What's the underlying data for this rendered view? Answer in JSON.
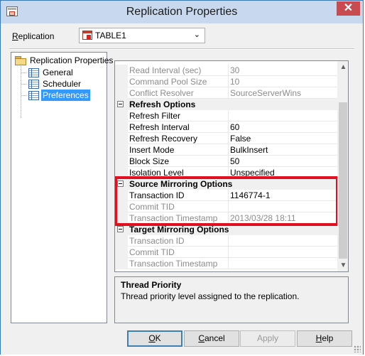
{
  "window": {
    "title": "Replication Properties",
    "close_glyph": "✕"
  },
  "replication": {
    "label_prefix": "",
    "label_mnemonic": "R",
    "label_rest": "eplication",
    "selected": "TABLE1",
    "chevron": "⌄"
  },
  "tree": {
    "root": "Replication Properties",
    "items": [
      {
        "label": "General",
        "selected": false
      },
      {
        "label": "Scheduler",
        "selected": false
      },
      {
        "label": "Preferences",
        "selected": true
      }
    ]
  },
  "grid": {
    "top_rows": [
      {
        "name": "Read Interval (sec)",
        "value": "30"
      },
      {
        "name": "Command Pool Size",
        "value": "10"
      },
      {
        "name": "Conflict Resolver",
        "value": "SourceServerWins"
      }
    ],
    "refresh": {
      "title": "Refresh Options",
      "rows": [
        {
          "name": "Refresh Filter",
          "value": ""
        },
        {
          "name": "Refresh Interval",
          "value": "60"
        },
        {
          "name": "Refresh Recovery",
          "value": "False"
        },
        {
          "name": "Insert Mode",
          "value": "BulkInsert"
        },
        {
          "name": "Block Size",
          "value": "50"
        },
        {
          "name": "Isolation Level",
          "value": "Unspecified"
        }
      ]
    },
    "source": {
      "title": "Source Mirroring Options",
      "rows": [
        {
          "name": "Transaction ID",
          "value": "1146774-1"
        },
        {
          "name": "Commit TID",
          "value": ""
        },
        {
          "name": "Transaction Timestamp",
          "value": "2013/03/28 18:11"
        }
      ]
    },
    "target": {
      "title": "Target Mirroring Options",
      "rows": [
        {
          "name": "Transaction ID",
          "value": ""
        },
        {
          "name": "Commit TID",
          "value": ""
        },
        {
          "name": "Transaction Timestamp",
          "value": ""
        }
      ]
    },
    "scroll_up": "▲",
    "scroll_down": "▼",
    "highlight_color": "#e01020"
  },
  "description": {
    "title": "Thread Priority",
    "text": "Thread priority level assigned to the replication."
  },
  "buttons": {
    "ok": {
      "m": "O",
      "rest": "K"
    },
    "cancel": {
      "m": "C",
      "rest": "ancel"
    },
    "apply": {
      "m": "",
      "rest": "Apply"
    },
    "help": {
      "m": "H",
      "rest": "elp"
    }
  }
}
